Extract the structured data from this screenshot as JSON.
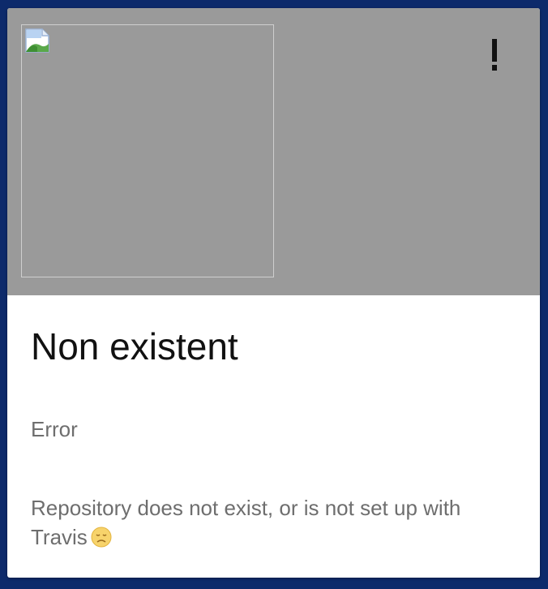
{
  "card": {
    "title": "Non existent",
    "status": "Error",
    "description": "Repository does not exist, or is not set up with Travis",
    "header_color": "#9a9a9a",
    "background_color": "#0d2a6b",
    "image_icon": "broken-image-icon",
    "status_icon": "exclamation-icon",
    "emoji_icon": "sad-face-emoji"
  }
}
